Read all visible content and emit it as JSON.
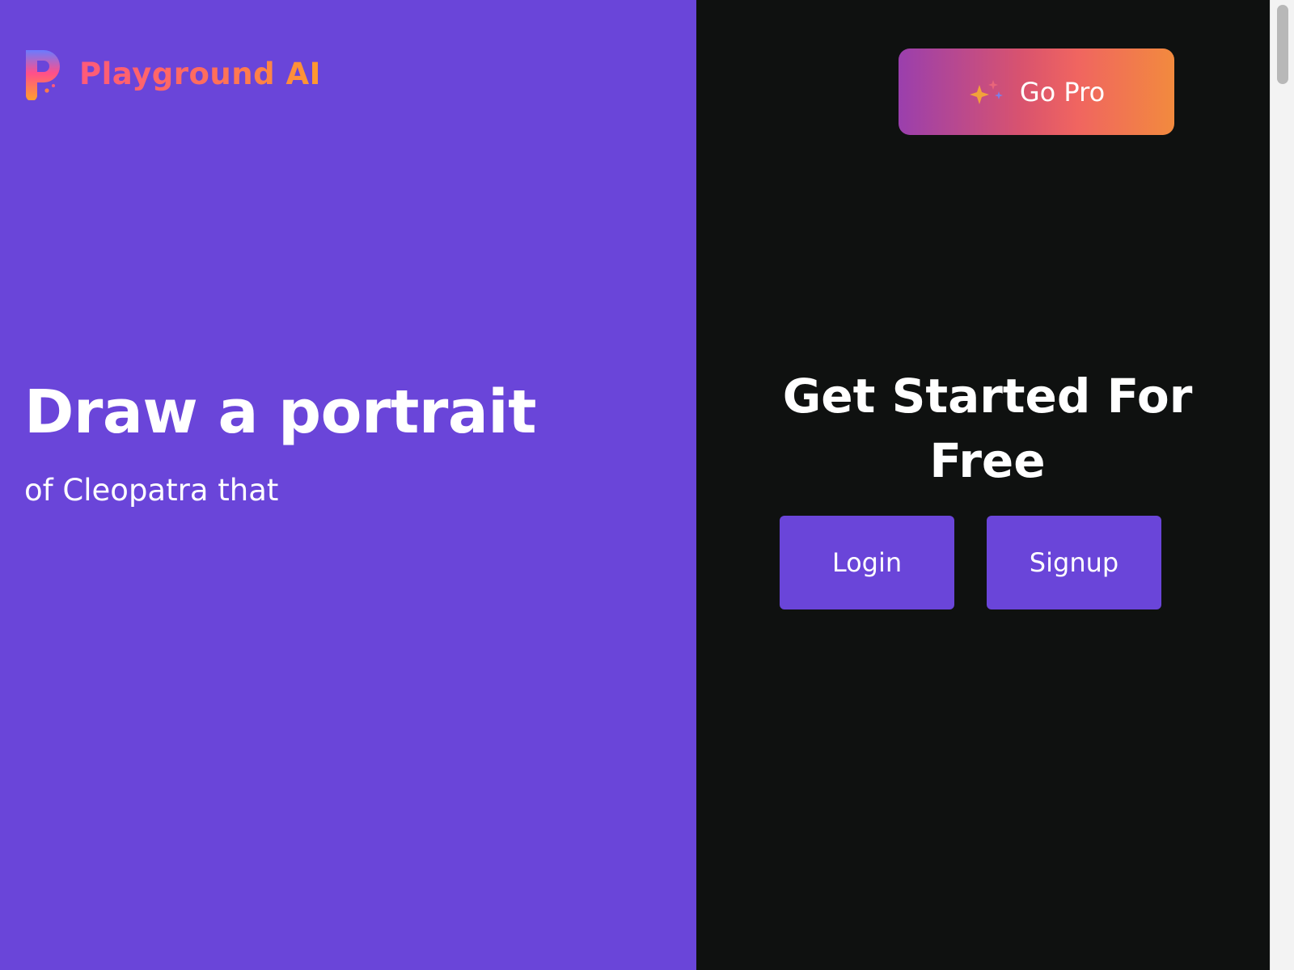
{
  "brand": {
    "name": "Playground AI",
    "logo_icon": "playground-p-logo",
    "gradient_colors": [
      "#ff5a7a",
      "#ff6e5c",
      "#ff9a2e"
    ]
  },
  "hero": {
    "title": "Draw a portrait",
    "subtitle": "of Cleopatra that"
  },
  "header": {
    "go_pro_label": "Go Pro",
    "go_pro_icon": "sparkle-icon"
  },
  "cta": {
    "heading": "Get Started For Free",
    "login_label": "Login",
    "signup_label": "Signup"
  },
  "colors": {
    "left_background": "#6a45d9",
    "right_background": "#0f1110",
    "button_purple": "#6a45d9",
    "go_pro_gradient": [
      "#9a3fad",
      "#f06560",
      "#f28a3e"
    ]
  }
}
